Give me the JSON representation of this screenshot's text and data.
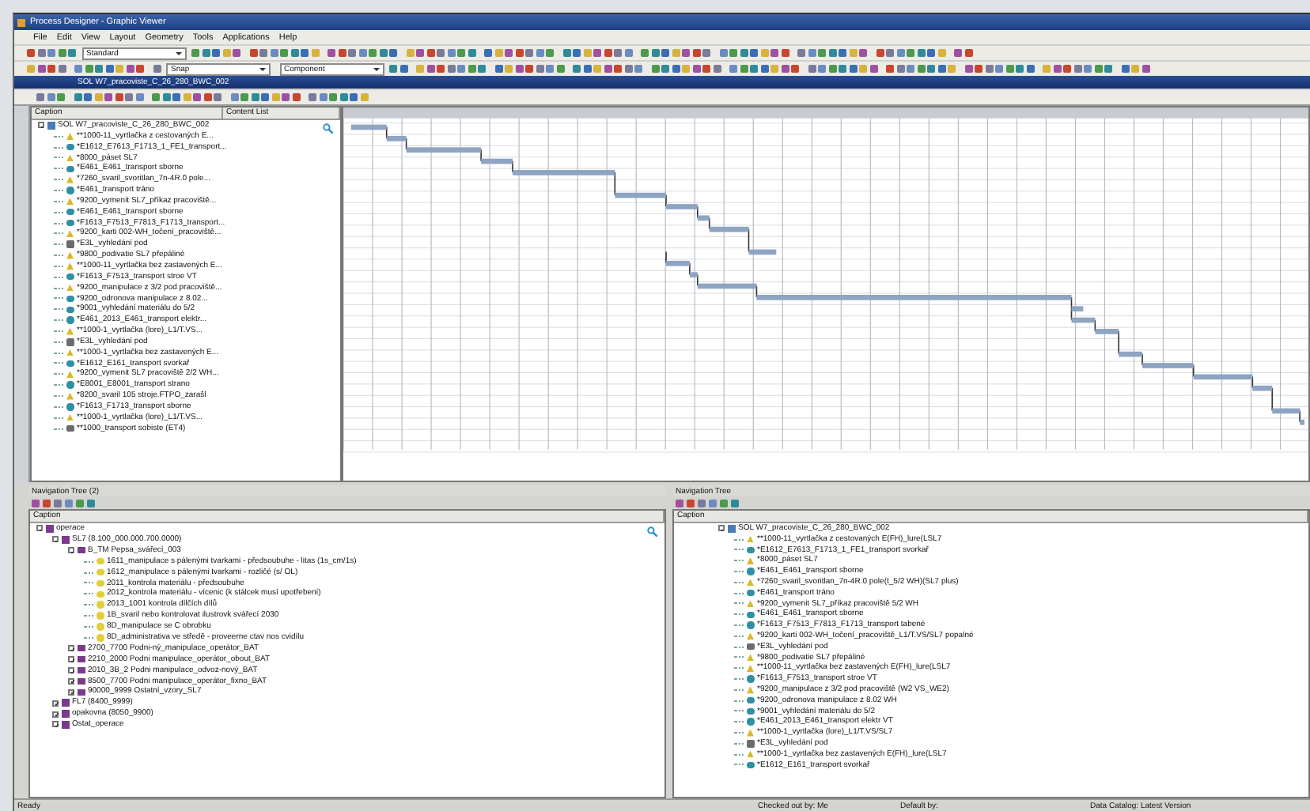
{
  "window": {
    "title": "Process Designer - Graphic Viewer"
  },
  "menu": [
    "File",
    "Edit",
    "View",
    "Layout",
    "Geometry",
    "Tools",
    "Applications",
    "Help"
  ],
  "toolbar_combos": [
    {
      "value": "Standard"
    },
    {
      "value": "Snap"
    },
    {
      "value": "Component"
    }
  ],
  "document": {
    "title": "SOL W7_pracoviste_C_26_280_BWC_002"
  },
  "gantt_tree": {
    "columns": [
      "Caption",
      "Content List"
    ],
    "nodes": [
      {
        "label": "SOL W7_pracoviste_C_26_280_BWC_002",
        "kind": "station",
        "expanded": true,
        "children": [
          {
            "label": "**1000-11_vyrtlačka z cestovaných E...",
            "kind": "operation"
          },
          {
            "label": "*E1612_E7613_F1713_1_FE1_transport...",
            "kind": "transport"
          },
          {
            "label": "*8000_páset SL7",
            "kind": "operation"
          },
          {
            "label": "*E461_E461_transport sborne",
            "kind": "transport"
          },
          {
            "label": "*7260_svaril_svoritlan_7n-4R.0 pole...",
            "kind": "operation"
          },
          {
            "label": "*E461_transport tráno",
            "kind": "transport"
          },
          {
            "label": "*9200_vymenit SL7_příkaz pracoviště...",
            "kind": "operation"
          },
          {
            "label": "*E461_E461_transport sborne",
            "kind": "transport"
          },
          {
            "label": "*F1613_F7513_F7813_F1713_transport...",
            "kind": "transport"
          },
          {
            "label": "*9200_karti 002-WH_točení_pracoviště...",
            "kind": "operation"
          },
          {
            "label": "*E3L_vyhledání pod",
            "kind": "wait"
          },
          {
            "label": "*9800_podivatie SL7 přepáliné",
            "kind": "operation"
          },
          {
            "label": "**1000-11_vyrtlačka bez zastavených E...",
            "kind": "operation"
          },
          {
            "label": "*F1613_F7513_transport stroe VT",
            "kind": "transport"
          },
          {
            "label": "*9200_manipulace z 3/2 pod pracoviště...",
            "kind": "operation"
          },
          {
            "label": "*9200_odronova manipulace z 8.02...",
            "kind": "transport"
          },
          {
            "label": "*9001_vyhledání materiálu do 5/2",
            "kind": "transport"
          },
          {
            "label": "*E461_2013_E461_transport elektr...",
            "kind": "transport"
          },
          {
            "label": "**1000-1_vyrtlačka (lore)_L1/T.VS...",
            "kind": "operation"
          },
          {
            "label": "*E3L_vyhledání pod",
            "kind": "wait"
          },
          {
            "label": "**1000-1_vyrtlačka bez zastavených E...",
            "kind": "operation"
          },
          {
            "label": "*E1612_E161_transport svorkař",
            "kind": "transport"
          },
          {
            "label": "*9200_vymenit SL7 pracoviště 2/2 WH...",
            "kind": "operation"
          },
          {
            "label": "*E8001_E8001_transport strano",
            "kind": "transport"
          },
          {
            "label": "*8200_svaril 105 stroje.FTPO_zarašl",
            "kind": "operation"
          },
          {
            "label": "*F1613_F1713_transport sborne",
            "kind": "transport"
          },
          {
            "label": "**1000-1_vyrtlačka (lore)_L1/T.VS...",
            "kind": "operation"
          },
          {
            "label": "**1000_transport sobiste (ET4)",
            "kind": "wait"
          }
        ]
      }
    ]
  },
  "nav_left": {
    "title": "Navigation Tree (2)",
    "columns": [
      "Caption"
    ],
    "nodes": [
      {
        "label": "operace",
        "kind": "folder",
        "expanded": true,
        "children": [
          {
            "label": "SL7 (8.100_000.000.700.0000)",
            "kind": "folder",
            "expanded": true,
            "children": [
              {
                "label": "B_TM Pepsa_svářecí_003",
                "kind": "folder",
                "expanded": true,
                "children": [
                  {
                    "label": "1611_manipulace s pálenými tvarkami - předsoubuhe - litas (1s_cm/1s)",
                    "kind": "step"
                  },
                  {
                    "label": "1612_manipulace s pálenými tvarkami - rozličé (s/ OL)",
                    "kind": "step"
                  },
                  {
                    "label": "2011_kontrola materiálu - předsoubuhe",
                    "kind": "step"
                  },
                  {
                    "label": "2012_kontrola materiálu - vícenic (k stálcek musí upotřebení)",
                    "kind": "step"
                  },
                  {
                    "label": "2013_1001 kontrola dílčích dílů",
                    "kind": "step"
                  },
                  {
                    "label": "1B_svaril nebo kontrolovat ilustrovk svářecí 2030",
                    "kind": "step"
                  },
                  {
                    "label": "8D_manipulace se C obrobku",
                    "kind": "step"
                  },
                  {
                    "label": "8D_administrativa ve středě - proveerne ctav nos cvidílu",
                    "kind": "step"
                  }
                ]
              },
              {
                "label": "2700_7700 Podni-ný_manipulace_operátor_BAT",
                "kind": "folder",
                "expanded": false
              },
              {
                "label": "2210_2000 Podni manipulace_operátor_obout_BAT",
                "kind": "folder",
                "expanded": false
              },
              {
                "label": "2010_3B_2 Podni manipulace_odvoz-nový_BAT",
                "kind": "folder",
                "expanded": false
              },
              {
                "label": "8500_7700 Podni manipulace_operátor_fixno_BAT",
                "kind": "folder",
                "expanded": false
              },
              {
                "label": "90000_9999 Ostatní_vzory_SL7",
                "kind": "folder",
                "expanded": false
              }
            ]
          },
          {
            "label": "FL7 (8400_9999)",
            "kind": "folder",
            "expanded": false
          },
          {
            "label": "opakovna (8050_9900)",
            "kind": "folder",
            "expanded": false
          },
          {
            "label": "Ostat_operace",
            "kind": "folder",
            "expanded": false
          }
        ]
      }
    ]
  },
  "nav_right": {
    "title": "Navigation Tree",
    "columns": [
      "Caption"
    ],
    "nodes": [
      {
        "label": "SOL W7_pracoviste_C_26_280_BWC_002",
        "kind": "station",
        "expanded": true,
        "children": [
          {
            "label": "**1000-11_vyrtlačka z cestovaných E(FH)_lure(LSL7",
            "kind": "operation"
          },
          {
            "label": "*E1612_E7613_F1713_1_FE1_transport svorkař",
            "kind": "transport"
          },
          {
            "label": "*8000_páset SL7",
            "kind": "operation"
          },
          {
            "label": "*E461_E461_transport sborne",
            "kind": "transport"
          },
          {
            "label": "*7260_svaril_svoritlan_7n-4R.0 pole(t_5/2 WH)(SL7 plus)",
            "kind": "operation"
          },
          {
            "label": "*E461_transport tráno",
            "kind": "transport"
          },
          {
            "label": "*9200_vymenit SL7_příkaz pracoviště 5/2 WH",
            "kind": "operation"
          },
          {
            "label": "*E461_E461_transport sborne",
            "kind": "transport"
          },
          {
            "label": "*F1613_F7513_F7813_F1713_transport tabené",
            "kind": "transport"
          },
          {
            "label": "*9200_karti 002-WH_točení_pracoviště_L1/T.VS/SL7 popalné",
            "kind": "operation"
          },
          {
            "label": "*E3L_vyhledání pod",
            "kind": "wait"
          },
          {
            "label": "*9800_podivatie SL7 přepáliné",
            "kind": "operation"
          },
          {
            "label": "**1000-11_vyrtlačka bez zastavených E(FH)_lure(LSL7",
            "kind": "operation"
          },
          {
            "label": "*F1613_F7513_transport stroe VT",
            "kind": "transport"
          },
          {
            "label": "*9200_manipulace z 3/2 pod pracoviště (W2 VS_WE2)",
            "kind": "operation"
          },
          {
            "label": "*9200_odronova manipulace z 8.02 WH",
            "kind": "transport"
          },
          {
            "label": "*9001_vyhledání materiálu do 5/2",
            "kind": "transport"
          },
          {
            "label": "*E461_2013_E461_transport elektr VT",
            "kind": "transport"
          },
          {
            "label": "**1000-1_vyrtlačka (lore)_L1/T.VS/SL7",
            "kind": "operation"
          },
          {
            "label": "*E3L_vyhledání pod",
            "kind": "wait"
          },
          {
            "label": "**1000-1_vyrtlačka bez zastavených E(FH)_lure(LSL7",
            "kind": "operation"
          },
          {
            "label": "*E1612_E161_transport svorkař",
            "kind": "transport"
          }
        ]
      }
    ]
  },
  "status_bar": [
    "Ready",
    "Checked out by: Me",
    "Default by:",
    "Data Catalog: Latest Version"
  ]
}
